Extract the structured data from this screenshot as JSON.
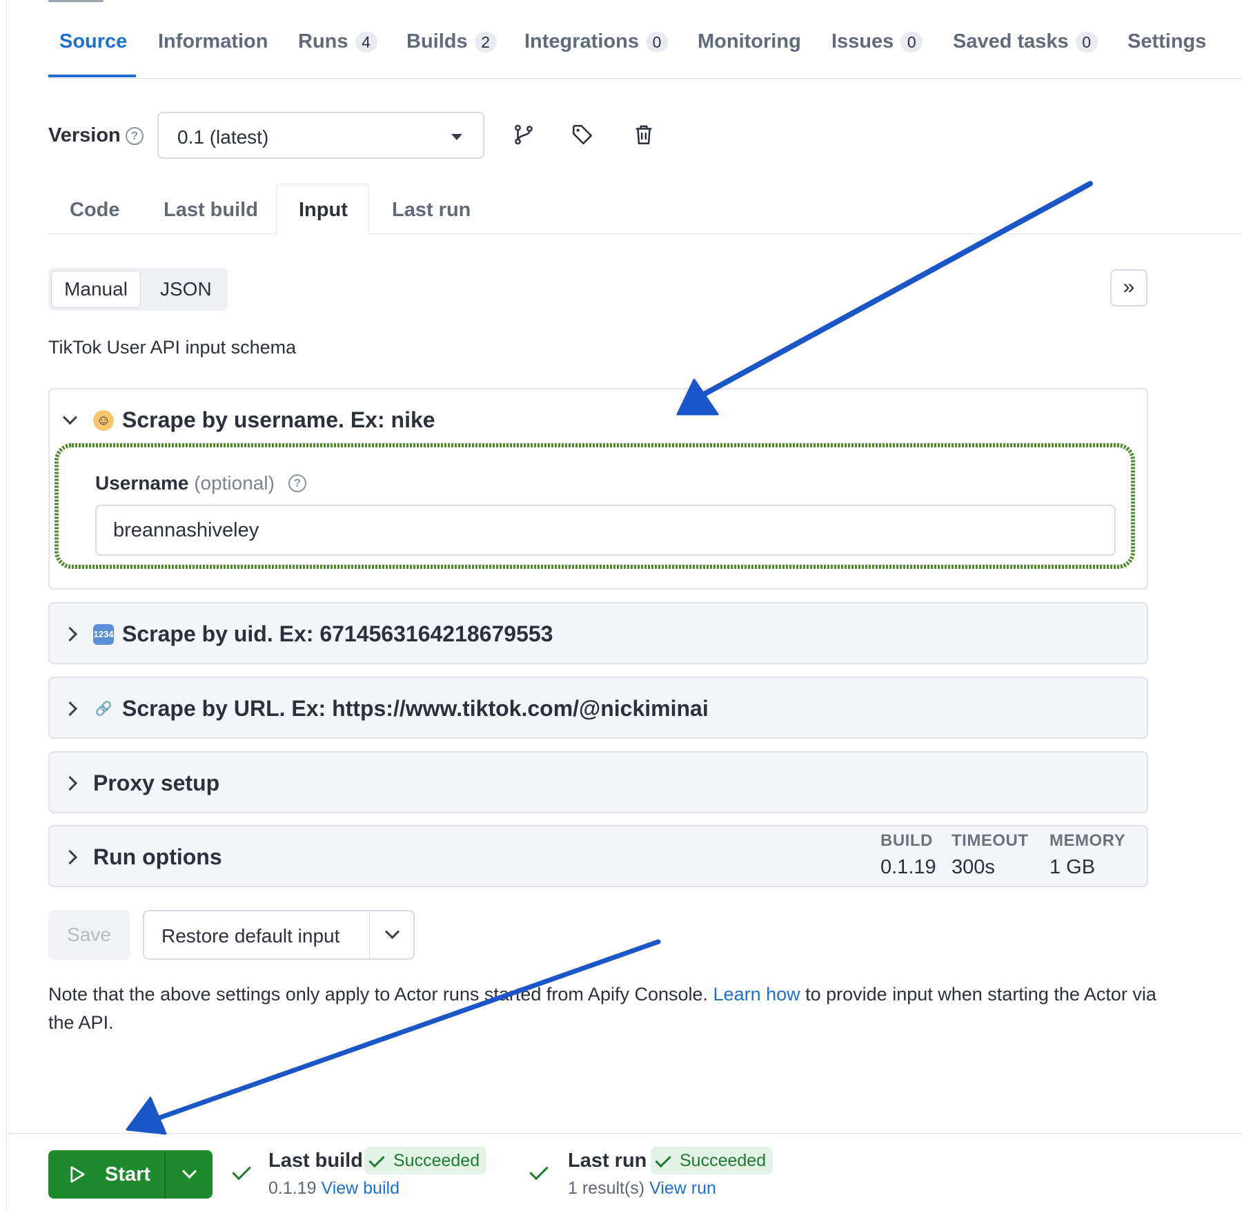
{
  "top_tabs": [
    {
      "label": "Source",
      "badge": null
    },
    {
      "label": "Information",
      "badge": null
    },
    {
      "label": "Runs",
      "badge": "4"
    },
    {
      "label": "Builds",
      "badge": "2"
    },
    {
      "label": "Integrations",
      "badge": "0"
    },
    {
      "label": "Monitoring",
      "badge": null
    },
    {
      "label": "Issues",
      "badge": "0"
    },
    {
      "label": "Saved tasks",
      "badge": "0"
    },
    {
      "label": "Settings",
      "badge": null
    }
  ],
  "active_top_tab": "Source",
  "version": {
    "label": "Version",
    "selected": "0.1 (latest)",
    "icons": [
      "branch-icon",
      "tag-icon",
      "trash-icon"
    ]
  },
  "sub_tabs": [
    "Code",
    "Last build",
    "Input",
    "Last run"
  ],
  "active_sub_tab": "Input",
  "mode_toggle": {
    "manual": "Manual",
    "json": "JSON",
    "active": "Manual"
  },
  "schema_title": "TikTok User API input schema",
  "sections": {
    "username": {
      "emoji": "person-emoji",
      "title": "Scrape by username. Ex: nike",
      "expanded": true,
      "field_label": "Username",
      "field_optional": "(optional)",
      "field_value": "breannashiveley"
    },
    "uid": {
      "emoji": "numbers-emoji",
      "title": "Scrape by uid. Ex: 6714563164218679553"
    },
    "url": {
      "emoji": "link-emoji",
      "title": "Scrape by URL. Ex: https://www.tiktok.com/@nickiminai"
    },
    "proxy": {
      "title": "Proxy setup"
    },
    "run_options": {
      "title": "Run options",
      "build_label": "BUILD",
      "build_value": "0.1.19",
      "timeout_label": "TIMEOUT",
      "timeout_value": "300s",
      "memory_label": "MEMORY",
      "memory_value": "1 GB"
    }
  },
  "buttons": {
    "save": "Save",
    "restore": "Restore default input"
  },
  "note": {
    "before": "Note that the above settings only apply to Actor runs started from Apify Console. ",
    "link": "Learn how",
    "after": " to provide input when starting the Actor via the API."
  },
  "footer": {
    "start": "Start",
    "last_build_title": "Last build",
    "last_build_status": "Succeeded",
    "last_build_version": "0.1.19",
    "last_build_link": "View build",
    "last_run_title": "Last run",
    "last_run_status": "Succeeded",
    "last_run_results": "1 result(s)",
    "last_run_link": "View run"
  },
  "colors": {
    "accent": "#1f6fd0",
    "start_green": "#1f8a2d",
    "success_bg": "#e3f3e6",
    "annotation_arrow": "#1b56c9",
    "annotation_box": "#4f8a2a"
  }
}
